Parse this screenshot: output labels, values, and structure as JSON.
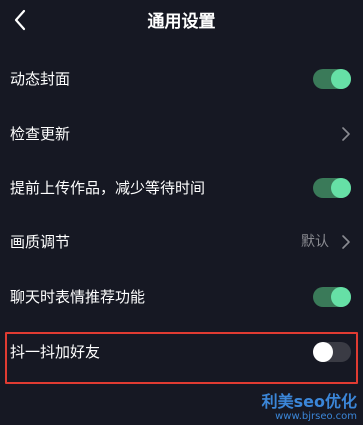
{
  "header": {
    "back_icon": "chevron-left-icon",
    "title": "通用设置"
  },
  "settings": {
    "dynamic_cover": {
      "label": "动态封面",
      "enabled": true
    },
    "check_update": {
      "label": "检查更新"
    },
    "upload_early": {
      "label": "提前上传作品，减少等待时间",
      "enabled": true
    },
    "picture_quality": {
      "label": "画质调节",
      "value": "默认"
    },
    "chat_emoji": {
      "label": "聊天时表情推荐功能",
      "enabled": true
    },
    "shake_add_friend": {
      "label": "抖一抖加好友",
      "enabled": false
    }
  },
  "colors": {
    "background": "#161823",
    "toggle_on_track": "#3a7a59",
    "toggle_on_knob": "#66e0a6",
    "highlight_border": "#e03b32"
  },
  "watermark": {
    "line1": "利美seo优化",
    "line2": "www.bjrseo.com"
  }
}
